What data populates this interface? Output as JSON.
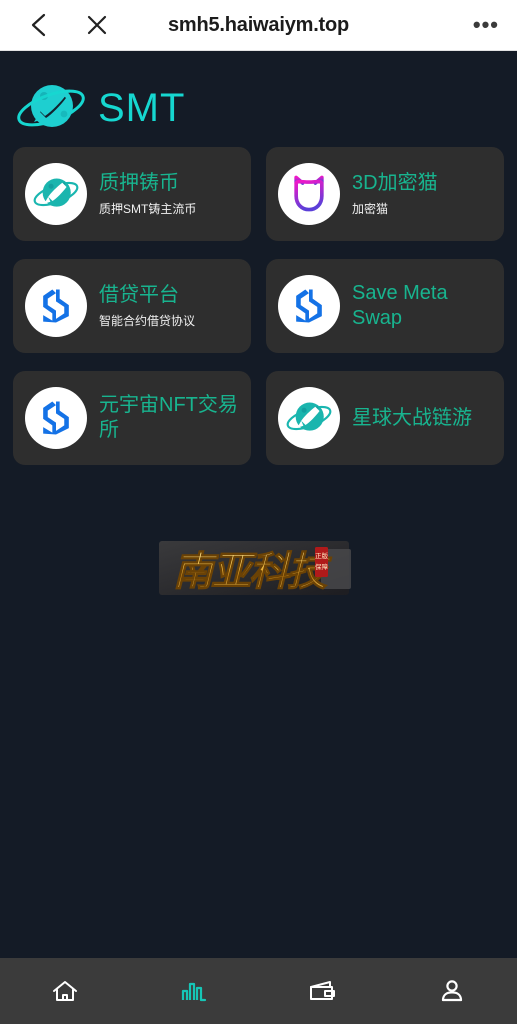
{
  "browser": {
    "url": "smh5.haiwaiym.top",
    "back_label": "‹",
    "close_label": "✕",
    "more_label": "•••"
  },
  "brand": {
    "name": "SMT",
    "logo_icon": "planet-rocket-icon",
    "accent_color": "#16d7d0"
  },
  "apps": [
    {
      "title": "质押铸币",
      "subtitle": "质押SMT铸主流币",
      "icon": "planet-rocket-icon"
    },
    {
      "title": "3D加密猫",
      "subtitle": "加密猫",
      "icon": "crypto-cat-icon"
    },
    {
      "title": "借贷平台",
      "subtitle": "智能合约借贷协议",
      "icon": "blue-s-swap-icon"
    },
    {
      "title": "Save Meta Swap",
      "subtitle": "",
      "icon": "blue-s-swap-icon"
    },
    {
      "title": "元宇宙NFT交易所",
      "subtitle": "",
      "icon": "blue-s-swap-icon"
    },
    {
      "title": "星球大战链游",
      "subtitle": "",
      "icon": "planet-rocket-icon"
    }
  ],
  "banner": {
    "text": "南亚科技",
    "seal_text": "正版保障",
    "alt": "gold-calligraphy-banner"
  },
  "tabbar": {
    "active_index": 1,
    "active_color": "#16c6b6",
    "inactive_color": "#ffffff",
    "items": [
      {
        "icon": "home-icon",
        "name": "home"
      },
      {
        "icon": "chart-icon",
        "name": "market"
      },
      {
        "icon": "wallet-icon",
        "name": "wallet"
      },
      {
        "icon": "person-icon",
        "name": "profile"
      }
    ]
  },
  "theme": {
    "page_bg": "#141b26",
    "card_bg": "#2e2e2e",
    "title_color": "#18b48f",
    "subtitle_color": "#f0f0f0",
    "tabbar_bg": "#3b3b3b"
  }
}
